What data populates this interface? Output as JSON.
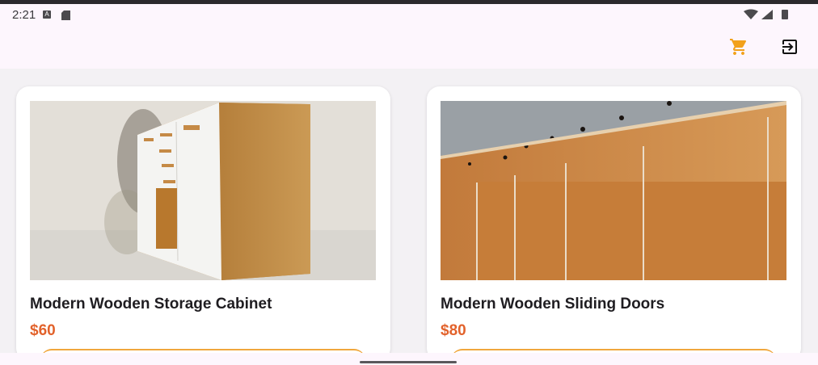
{
  "status_bar": {
    "time": "2:21",
    "left_icons": [
      "a-keyboard-icon",
      "sd-card-icon"
    ],
    "right_icons": [
      "wifi-icon",
      "signal-icon",
      "battery-icon"
    ]
  },
  "app_bar": {
    "cart_icon": "shopping-cart-icon",
    "logout_icon": "logout-icon",
    "accent_color": "#f2a11b"
  },
  "products": [
    {
      "title": "Modern Wooden Storage Cabinet",
      "price": "$60"
    },
    {
      "title": "Modern Wooden Sliding Doors",
      "price": "$80"
    }
  ],
  "colors": {
    "price": "#e2622b",
    "button_outline": "#f0a73d",
    "surface": "#fdf6fd",
    "background": "#f3f1f4"
  }
}
